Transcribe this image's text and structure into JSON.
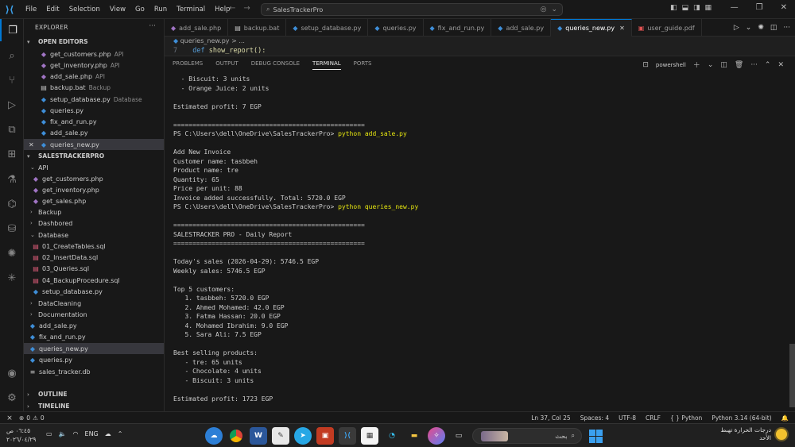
{
  "titlebar": {
    "menu": [
      "File",
      "Edit",
      "Selection",
      "View",
      "Go",
      "Run",
      "Terminal",
      "Help"
    ],
    "search": "SalesTrackerPro"
  },
  "sidebar": {
    "title": "EXPLORER",
    "open_editors_label": "OPEN EDITORS",
    "open_editors": [
      {
        "name": "get_customers.php",
        "hint": "API",
        "icon": "php"
      },
      {
        "name": "get_inventory.php",
        "hint": "API",
        "icon": "php"
      },
      {
        "name": "add_sale.php",
        "hint": "API",
        "icon": "php"
      },
      {
        "name": "backup.bat",
        "hint": "Backup",
        "icon": "bat"
      },
      {
        "name": "setup_database.py",
        "hint": "Database",
        "icon": "py"
      },
      {
        "name": "queries.py",
        "hint": "",
        "icon": "py"
      },
      {
        "name": "fix_and_run.py",
        "hint": "",
        "icon": "py"
      },
      {
        "name": "add_sale.py",
        "hint": "",
        "icon": "py"
      },
      {
        "name": "queries_new.py",
        "hint": "",
        "icon": "py"
      }
    ],
    "project_label": "SALESTRACKERPRO",
    "tree": {
      "api": "API",
      "api_files": [
        "get_customers.php",
        "get_inventory.php",
        "get_sales.php"
      ],
      "backup": "Backup",
      "dashbored": "Dashbored",
      "database": "Database",
      "database_files": [
        "01_CreateTables.sql",
        "02_InsertData.sql",
        "03_Queries.sql",
        "04_BackupProcedure.sql",
        "setup_database.py"
      ],
      "datacleaning": "DataCleaning",
      "documentation": "Documentation",
      "root_files": [
        "add_sale.py",
        "fix_and_run.py",
        "queries_new.py",
        "queries.py",
        "sales_tracker.db"
      ]
    },
    "outline": "OUTLINE",
    "timeline": "TIMELINE"
  },
  "tabs": [
    {
      "label": "add_sale.php",
      "icon": "php"
    },
    {
      "label": "backup.bat",
      "icon": "bat"
    },
    {
      "label": "setup_database.py",
      "icon": "py"
    },
    {
      "label": "queries.py",
      "icon": "py"
    },
    {
      "label": "fix_and_run.py",
      "icon": "py"
    },
    {
      "label": "add_sale.py",
      "icon": "py"
    },
    {
      "label": "queries_new.py",
      "icon": "py",
      "active": true
    },
    {
      "label": "user_guide.pdf",
      "icon": "pdf"
    }
  ],
  "editor": {
    "breadcrumb": "queries_new.py > ...",
    "line_number": "7",
    "code_keyword": "def",
    "code_fn": "show_report():"
  },
  "panel": {
    "tabs": [
      "PROBLEMS",
      "OUTPUT",
      "DEBUG CONSOLE",
      "TERMINAL",
      "PORTS"
    ],
    "active_tab": "TERMINAL",
    "shell": "powershell"
  },
  "terminal_lines": [
    {
      "text": "  - Biscuit: 3 units"
    },
    {
      "text": "  - Orange Juice: 2 units"
    },
    {
      "text": ""
    },
    {
      "text": "Estimated profit: 7 EGP"
    },
    {
      "text": ""
    },
    {
      "text": "=================================================="
    },
    {
      "text": "PS C:\\Users\\dell\\OneDrive\\SalesTrackerPro> ",
      "cmd": "python add_sale.py"
    },
    {
      "text": ""
    },
    {
      "text": "Add New Invoice"
    },
    {
      "text": "Customer name: tasbbeh"
    },
    {
      "text": "Product name: tre"
    },
    {
      "text": "Quantity: 65"
    },
    {
      "text": "Price per unit: 88"
    },
    {
      "text": "Invoice added successfully. Total: 5720.0 EGP"
    },
    {
      "text": "PS C:\\Users\\dell\\OneDrive\\SalesTrackerPro> ",
      "cmd": "python queries_new.py"
    },
    {
      "text": ""
    },
    {
      "text": "=================================================="
    },
    {
      "text": "SALESTRACKER PRO - Daily Report"
    },
    {
      "text": "=================================================="
    },
    {
      "text": ""
    },
    {
      "text": "Today's sales (2026-04-29): 5746.5 EGP"
    },
    {
      "text": "Weekly sales: 5746.5 EGP"
    },
    {
      "text": ""
    },
    {
      "text": "Top 5 customers:"
    },
    {
      "text": "   1. tasbbeh: 5720.0 EGP"
    },
    {
      "text": "   2. Ahmed Mohamed: 42.0 EGP"
    },
    {
      "text": "   3. Fatma Hassan: 20.0 EGP"
    },
    {
      "text": "   4. Mohamed Ibrahim: 9.0 EGP"
    },
    {
      "text": "   5. Sara Ali: 7.5 EGP"
    },
    {
      "text": ""
    },
    {
      "text": "Best selling products:"
    },
    {
      "text": "   - tre: 65 units"
    },
    {
      "text": "   - Chocolate: 4 units"
    },
    {
      "text": "   - Biscuit: 3 units"
    },
    {
      "text": ""
    },
    {
      "text": "Estimated profit: 1723 EGP"
    }
  ],
  "statusbar": {
    "errors": "0",
    "warnings": "0",
    "position": "Ln 37, Col 25",
    "spaces": "Spaces: 4",
    "encoding": "UTF-8",
    "eol": "CRLF",
    "language": "Python",
    "interpreter": "Python 3.14 (64-bit)"
  },
  "taskbar": {
    "time": "٠٦:٤٥ ص",
    "date": "٢٠٢٦/٠٤/٢٩",
    "lang": "ENG",
    "search": "بحث",
    "weather_line1": "درجات الحرارة تهبط",
    "weather_line2": "الأحد"
  },
  "colors": {
    "accent": "#0078d4",
    "terminal_cmd": "#e5e510"
  }
}
